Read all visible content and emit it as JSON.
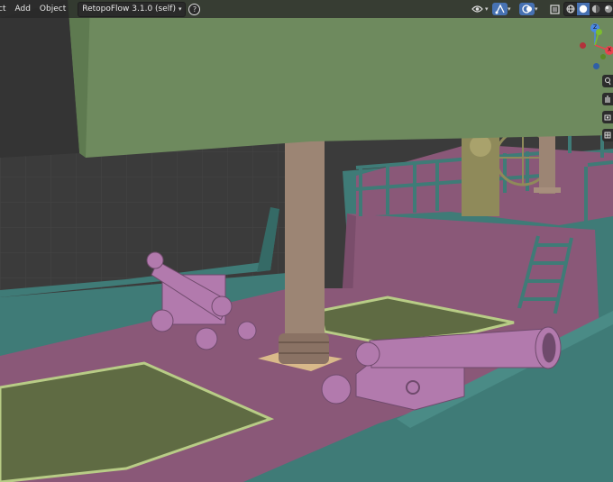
{
  "header": {
    "menu": [
      "ct",
      "Add",
      "Object"
    ],
    "addon_name": "RetopoFlow 3.1.0 (self)",
    "help_glyph": "?"
  },
  "toolbar": {
    "icons": [
      "eye-visibility-icon",
      "gizmo-icon",
      "overlay-icon",
      "xray-icon"
    ],
    "shading": [
      "wireframe-shading-icon",
      "solid-shading-icon",
      "material-shading-icon",
      "rendered-shading-icon"
    ],
    "active_shading": "solid"
  },
  "gizmo": {
    "z_label": "Z",
    "x_label": "X",
    "colors": {
      "x": "#e8444f",
      "y": "#7cbd2f",
      "z": "#4a88e5"
    }
  },
  "scene": {
    "sail_color": "#6e8a5e",
    "hull_color": "#3f7b77",
    "deck_color": "#8a5878",
    "cannon_color": "#b27aad",
    "mast_color": "#9c8574",
    "grate_color": "#5f6b43",
    "wheel_color": "#8f8a5a"
  }
}
